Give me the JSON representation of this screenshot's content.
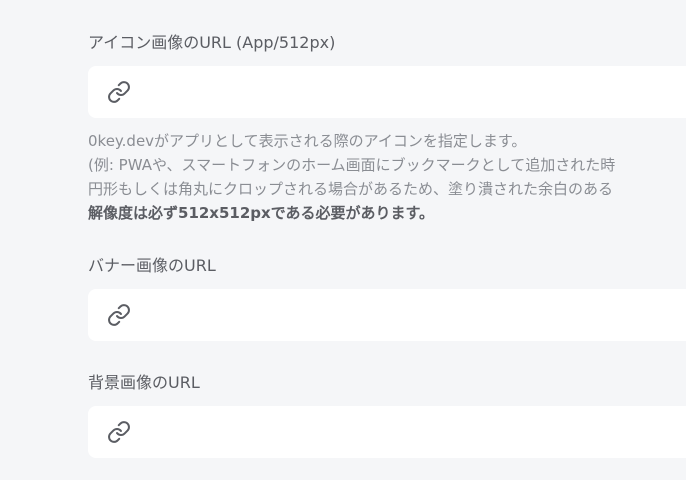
{
  "icon_field": {
    "label": "アイコン画像のURL (App/512px)",
    "value": "",
    "placeholder": "",
    "help_lines": [
      "0key.devがアプリとして表示される際のアイコンを指定します。",
      "(例: PWAや、スマートフォンのホーム画面にブックマークとして追加された時",
      "円形もしくは角丸にクロップされる場合があるため、塗り潰された余白のある"
    ],
    "help_strong": "解像度は必ず512x512pxである必要があります。",
    "icon": "link-icon"
  },
  "banner_field": {
    "label": "バナー画像のURL",
    "value": "",
    "placeholder": "",
    "icon": "link-icon"
  },
  "background_field": {
    "label": "背景画像のURL",
    "value": "",
    "placeholder": "",
    "icon": "link-icon"
  }
}
